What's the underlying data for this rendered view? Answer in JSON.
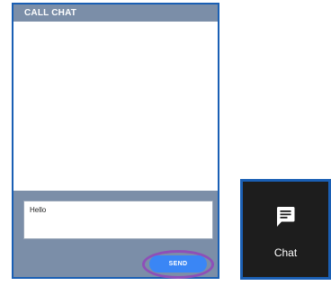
{
  "chat_panel": {
    "title": "CALL CHAT",
    "input_value": "Hello",
    "send_label": "SEND",
    "send_highlight_color": "#8e4fb8"
  },
  "chat_launcher": {
    "icon": "chat-bubble-icon",
    "label": "Chat"
  },
  "colors": {
    "panel_border": "#1a5fb4",
    "header_bg": "#7b8ea8",
    "send_button": "#3a86f5",
    "launcher_bg": "#1d1d1d"
  }
}
